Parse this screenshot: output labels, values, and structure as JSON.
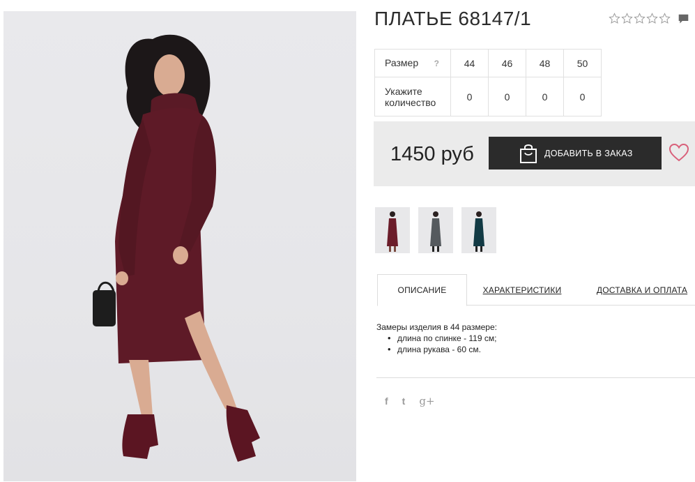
{
  "product": {
    "title": "ПЛАТЬЕ 68147/1",
    "rating": 0,
    "rating_max": 5,
    "price": "1450 руб",
    "order_button_label": "ДОБАВИТЬ В ЗАКАЗ"
  },
  "size_table": {
    "size_label": "Размер",
    "help_label": "?",
    "qty_label_line1": "Укажите",
    "qty_label_line2": "количество",
    "sizes": [
      "44",
      "46",
      "48",
      "50"
    ],
    "quantities": [
      "0",
      "0",
      "0",
      "0"
    ]
  },
  "thumbnails": [
    {
      "color": "#6b1d2a",
      "name": "burgundy"
    },
    {
      "color": "#555a5e",
      "name": "grey"
    },
    {
      "color": "#123a44",
      "name": "teal"
    }
  ],
  "tabs": {
    "items": [
      "ОПИСАНИЕ",
      "ХАРАКТЕРИСТИКИ",
      "ДОСТАВКА И ОПЛАТА"
    ],
    "active": 0
  },
  "description": {
    "intro": "Замеры изделия в 44 размере:",
    "items": [
      "длина по спинке - 119 см;",
      "длина рукава - 60 см."
    ]
  },
  "social": {
    "facebook": "f",
    "twitter": "t",
    "google": "g+"
  },
  "colors": {
    "dress": "#5e1a27",
    "button": "#2b2b2b",
    "heart": "#d9607a",
    "price_box": "#ebebeb"
  }
}
